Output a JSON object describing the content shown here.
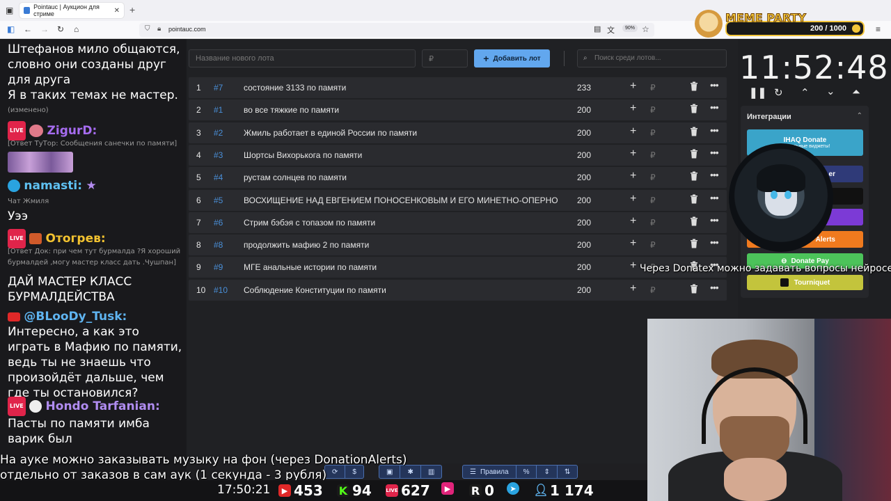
{
  "browser": {
    "tab_title": "Pointauc | Аукцион для стриме",
    "tab_close": "✕",
    "new_tab": "+",
    "url": "pointauc.com",
    "zoom": "90%"
  },
  "meme_party": {
    "title": "MEME PARTY",
    "progress_text": "200 / 1000",
    "progress": 0.2
  },
  "chat": {
    "messages": [
      {
        "text": "Штефанов мило общаются, словно они созданы друг для друга"
      },
      {
        "text": "Я в таких темах не мастер."
      },
      {
        "edited": "(изменено)"
      },
      {
        "user": "ZigurD:",
        "reply": "[Ответ ТуТор: Сообщения санечки по памяти]"
      },
      {
        "user": "namasti:",
        "source": "Чат Жмиля",
        "text": "Уээ"
      },
      {
        "user": "Отогрев:",
        "reply": "[Ответ Док: при чем тут бурмалда ?Я хороший бурмалдей ,могу мастер класс дать .Чушпан]",
        "text": "ДАЙ МАСТЕР КЛАСС БУРМАЛДЕЙСТВА"
      },
      {
        "user": "@BLooDy_Tusk:",
        "text": "Интересно, а как это играть в Мафию по памяти, ведь ты не знаешь что произойдёт дальше, чем где ты остановился?"
      },
      {
        "user": "Hondo Tarfanian:",
        "text": "Пасты по памяти имба варик был"
      }
    ],
    "live_badge": "LIVE"
  },
  "controls": {
    "lot_placeholder": "Название нового лота",
    "price_placeholder": "₽",
    "add_button": "Добавить лот",
    "search_placeholder": "Поиск среди лотов..."
  },
  "lots": [
    {
      "num": "1",
      "id": "#7",
      "name": "состояние 3133 по памяти",
      "amount": "233"
    },
    {
      "num": "2",
      "id": "#1",
      "name": "во все тяжкие по памяти",
      "amount": "200"
    },
    {
      "num": "3",
      "id": "#2",
      "name": "Жмиль работает в единой России по памяти",
      "amount": "200"
    },
    {
      "num": "4",
      "id": "#3",
      "name": "Шортсы Вихорькога по памяти",
      "amount": "200"
    },
    {
      "num": "5",
      "id": "#4",
      "name": "рустам солнцев по памяти",
      "amount": "200"
    },
    {
      "num": "6",
      "id": "#5",
      "name": "ВОСХИЩЕНИЕ НАД ЕВГЕНИЕМ ПОНОСЕНКОВЫМ И ЕГО МИНЕТНО-ОПЕРНО-",
      "amount": "200"
    },
    {
      "num": "7",
      "id": "#6",
      "name": "Стрим бэбэя с топазом по памяти",
      "amount": "200"
    },
    {
      "num": "8",
      "id": "#8",
      "name": "продолжить мафию 2 по памяти",
      "amount": "200"
    },
    {
      "num": "9",
      "id": "#9",
      "name": "МГЕ анальные истории по памяти",
      "amount": "200"
    },
    {
      "num": "10",
      "id": "#10",
      "name": "Соблюдение Конституции по памяти",
      "amount": "200"
    }
  ],
  "row_symbols": {
    "plus": "+",
    "rub": "₽",
    "dots": "•••"
  },
  "timer": {
    "display": "11:52:48"
  },
  "integrations": {
    "title": "Интеграции",
    "buttons": [
      {
        "label": "IHAQ Donate",
        "sub": "Уникальные виджеты!",
        "color": "#3aa4c9"
      },
      {
        "label": "er",
        "color": "#2f3a78"
      },
      {
        "label": "",
        "color": "#111111"
      },
      {
        "label": "",
        "color": "#7c3ad6"
      },
      {
        "label": "Alerts",
        "color": "#f07a1e"
      },
      {
        "label": "Donate Pay",
        "color": "#4cc35a"
      },
      {
        "label": "Tourniquet",
        "color": "#c3c43c"
      }
    ]
  },
  "overlay_right": "Через Donatex можно задавать вопросы нейросети",
  "ticker": {
    "line1": "На ауке можно заказывать музыку на фон (через DonationAlerts)",
    "line2": "отдельно от заказов в сам аук (1 секунда - 3 рубля)"
  },
  "toolbar": {
    "rules": "Правила",
    "percent": "%"
  },
  "stats": {
    "time": "17:50:21",
    "youtube": "453",
    "kick": "94",
    "vk": "627",
    "rutube": "0",
    "telegram": "",
    "viewers": "1 174"
  },
  "colors": {
    "accent": "#62a7ee",
    "id_blue": "#4a8fd8",
    "panel": "#202124",
    "row": "#2a2b2f"
  }
}
